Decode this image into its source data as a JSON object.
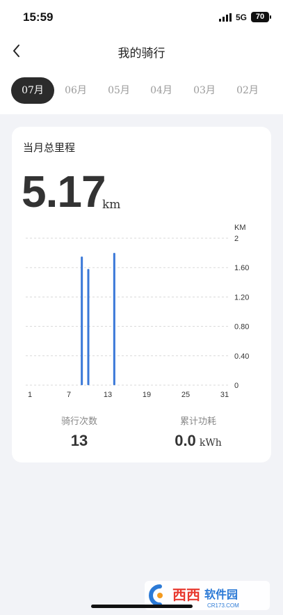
{
  "status_bar": {
    "time": "15:59",
    "network": "5G",
    "battery": "70"
  },
  "nav": {
    "title": "我的骑行",
    "back_icon": "chevron-left-icon"
  },
  "months": [
    {
      "label": "07月",
      "active": true
    },
    {
      "label": "06月",
      "active": false
    },
    {
      "label": "05月",
      "active": false
    },
    {
      "label": "04月",
      "active": false
    },
    {
      "label": "03月",
      "active": false
    },
    {
      "label": "02月",
      "active": false
    }
  ],
  "summary": {
    "title": "当月总里程",
    "total": "5.17",
    "unit": "km"
  },
  "stats": {
    "rides_label": "骑行次数",
    "rides_value": "13",
    "energy_label": "累计功耗",
    "energy_value": "0.0",
    "energy_unit": "kWh"
  },
  "watermark": {
    "text1": "西西",
    "text2": "软件园",
    "url": "CR173.COM"
  },
  "colors": {
    "bar": "#3a78d8",
    "active_tab": "#2b2b2b",
    "background": "#f2f3f7"
  },
  "chart_data": {
    "type": "bar",
    "ylabel": "KM",
    "ylim": [
      0,
      2
    ],
    "yticks": [
      "2",
      "1.60",
      "1.20",
      "0.80",
      "0.40",
      "0"
    ],
    "xlim": [
      1,
      31
    ],
    "xticks": [
      "1",
      "7",
      "13",
      "19",
      "25",
      "31"
    ],
    "series": [
      {
        "x": [
          9,
          10,
          14
        ],
        "values": [
          1.75,
          1.58,
          1.8
        ]
      }
    ],
    "grid": true
  }
}
